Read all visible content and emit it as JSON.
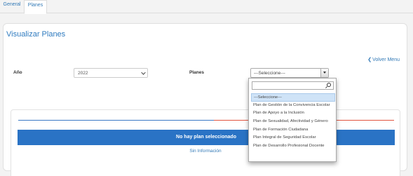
{
  "tabs": [
    {
      "label": "General"
    },
    {
      "label": "Planes"
    }
  ],
  "panel": {
    "title": "Visualizar Planes",
    "back_link": "Volver Menu"
  },
  "form": {
    "anio_label": "Año",
    "anio_value": "2022",
    "planes_label": "Planes",
    "planes_value": "---Seleccione---"
  },
  "dropdown": {
    "search_value": "",
    "options": [
      "---Seleccione---",
      "Plan de Gestión de la Convivencia Escolar",
      "Plan de Apoyo a la Inclusión",
      "Plan de Sexualidad, Afectividad y Género",
      "Plan de Formación Ciudadana",
      "Plan Integral de Seguridad Escolar",
      "Plan de Desarrollo Profesional Docente"
    ],
    "selected_index": 0
  },
  "result": {
    "message": "No hay plan seleccionado",
    "info": "Sin Información"
  },
  "colors": {
    "accent": "#2a73c5",
    "title": "#2f7bbf",
    "link": "#337ab7",
    "line_red": "#e0533f"
  }
}
